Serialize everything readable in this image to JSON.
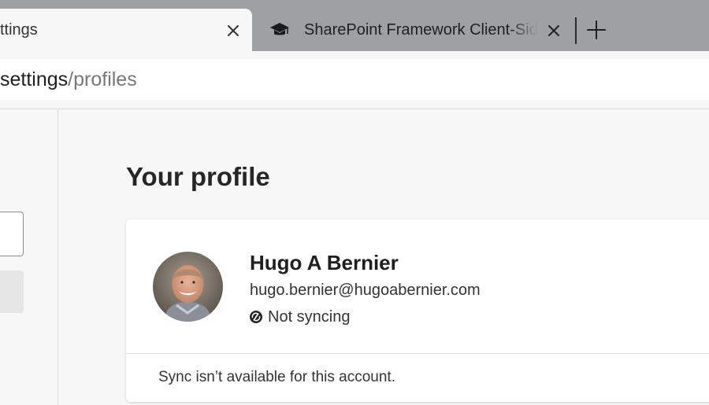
{
  "tabs": [
    {
      "title": "ttings",
      "active": true
    },
    {
      "title": "SharePoint Framework Client-Sid",
      "active": false,
      "favicon": "graduation-cap-icon"
    }
  ],
  "address_bar": {
    "host": "settings",
    "path": "/profiles"
  },
  "main": {
    "title": "Your profile",
    "profile": {
      "name": "Hugo A Bernier",
      "email": "hugo.bernier@hugoabernier.com",
      "sync_status": "Not syncing",
      "sync_message": "Sync isn’t available for this account."
    }
  },
  "colors": {
    "tabstrip": "#9ea1a4",
    "page_background": "#f7f7f7",
    "card_background": "#ffffff"
  }
}
